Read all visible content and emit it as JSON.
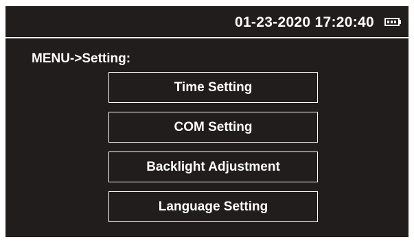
{
  "status": {
    "datetime": "01-23-2020 17:20:40",
    "battery_icon": "battery-icon",
    "battery_level": 1.0
  },
  "menu": {
    "title": "MENU->Setting:",
    "items": [
      {
        "label": "Time Setting"
      },
      {
        "label": "COM Setting"
      },
      {
        "label": "Backlight Adjustment"
      },
      {
        "label": "Language Setting"
      }
    ]
  },
  "colors": {
    "background": "#221d1d",
    "foreground": "#ffffff"
  }
}
